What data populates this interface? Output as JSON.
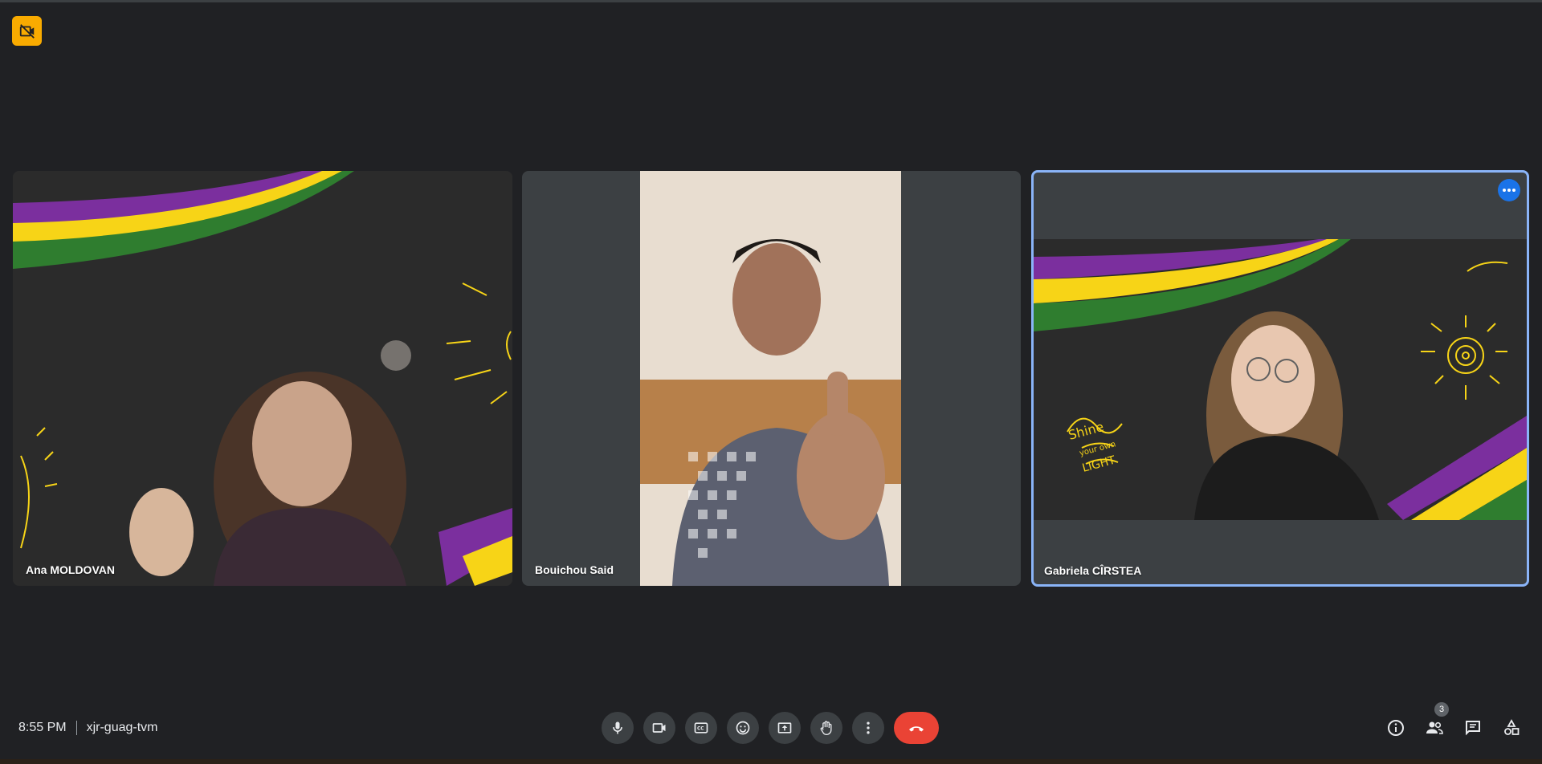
{
  "meeting": {
    "time": "8:55 PM",
    "code": "xjr-guag-tvm",
    "participant_count": "3"
  },
  "participants": [
    {
      "name": "Ana MOLDOVAN"
    },
    {
      "name": "Bouichou Said"
    },
    {
      "name": "Gabriela CÎRSTEA"
    }
  ],
  "icons": {
    "recording": "no-camera-badge-icon",
    "more": "more-options-icon",
    "mic": "microphone-icon",
    "camera": "video-camera-icon",
    "captions": "captions-icon",
    "emoji": "emoji-icon",
    "present": "present-screen-icon",
    "hand": "raise-hand-icon",
    "more_options": "more-vert-icon",
    "end_call": "end-call-icon",
    "info": "info-icon",
    "people": "people-icon",
    "chat": "chat-icon",
    "activities": "activities-icon"
  },
  "colors": {
    "background": "#202124",
    "tile": "#3c4043",
    "active_border": "#8ab4f8",
    "end_call": "#ea4335",
    "badge": "#f9ab00",
    "accent_blue": "#1a73e8"
  }
}
